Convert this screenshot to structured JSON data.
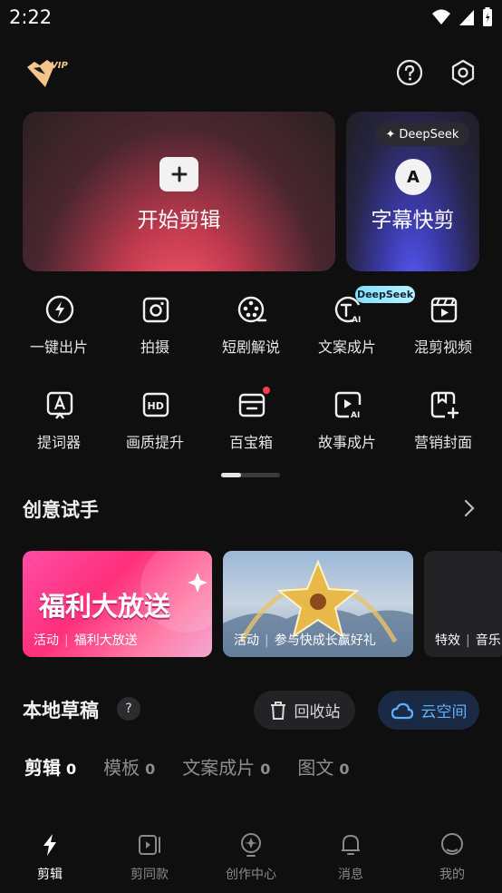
{
  "status_bar": {
    "time": "2:22"
  },
  "header": {
    "vip_label": "VIP"
  },
  "hero": {
    "start_edit_label": "开始剪辑",
    "subtitle_label": "字幕快剪",
    "deepseek_badge": "DeepSeek",
    "subtitle_icon_letter": "A"
  },
  "tools": [
    {
      "label": "一键出片",
      "icon": "lightning-circle-icon"
    },
    {
      "label": "拍摄",
      "icon": "camera-icon"
    },
    {
      "label": "短剧解说",
      "icon": "film-reel-icon"
    },
    {
      "label": "文案成片",
      "icon": "text-ai-icon",
      "badge": "DeepSeek"
    },
    {
      "label": "混剪视频",
      "icon": "clapper-icon"
    },
    {
      "label": "提词器",
      "icon": "teleprompter-icon"
    },
    {
      "label": "画质提升",
      "icon": "hd-icon"
    },
    {
      "label": "百宝箱",
      "icon": "toolbox-icon",
      "has_dot": true
    },
    {
      "label": "故事成片",
      "icon": "video-ai-icon"
    },
    {
      "label": "营销封面",
      "icon": "bookmark-cover-icon"
    }
  ],
  "creative": {
    "title": "创意试手",
    "promos": [
      {
        "big_text": "福利大放送",
        "tag": "活动",
        "caption": "福利大放送"
      },
      {
        "tag": "活动",
        "caption": "参与快成长赢好礼"
      },
      {
        "tag": "特效",
        "caption": "音乐"
      }
    ]
  },
  "drafts": {
    "title": "本地草稿",
    "help": "?",
    "trash_label": "回收站",
    "cloud_label": "云空间",
    "tabs": [
      {
        "label": "剪辑",
        "count": "0",
        "active": true
      },
      {
        "label": "模板",
        "count": "0"
      },
      {
        "label": "文案成片",
        "count": "0"
      },
      {
        "label": "图文",
        "count": "0"
      }
    ]
  },
  "bottom_nav": [
    {
      "label": "剪辑",
      "icon": "edit-lightning-icon",
      "active": true
    },
    {
      "label": "剪同款",
      "icon": "template-video-icon"
    },
    {
      "label": "创作中心",
      "icon": "lightbulb-icon"
    },
    {
      "label": "消息",
      "icon": "bell-icon"
    },
    {
      "label": "我的",
      "icon": "profile-icon"
    }
  ],
  "colors": {
    "accent_blue": "#5fb0ff",
    "promo_pink": "#ff2f7a",
    "background": "#0f0f10"
  }
}
